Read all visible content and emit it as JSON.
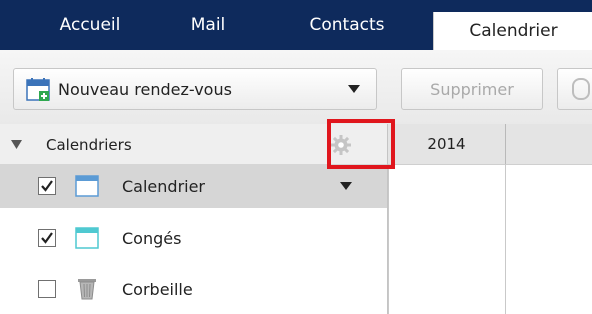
{
  "nav": {
    "tabs": [
      {
        "label": "Accueil"
      },
      {
        "label": "Mail"
      },
      {
        "label": "Contacts"
      },
      {
        "label": "Calendrier",
        "active": true
      }
    ]
  },
  "toolbar": {
    "new_label": "Nouveau rendez-vous",
    "delete_label": "Supprimer"
  },
  "sidebar": {
    "section_title": "Calendriers",
    "items": [
      {
        "label": "Calendrier",
        "checked": true,
        "icon": "calendar-icon"
      },
      {
        "label": "Congés",
        "checked": true,
        "icon": "calendar-icon"
      },
      {
        "label": "Corbeille",
        "checked": false,
        "icon": "trash-icon"
      }
    ]
  },
  "calendar": {
    "year": "2014"
  },
  "colors": {
    "nav_bg": "#0e2a5c",
    "highlight": "#e0161d",
    "calendar_icon": "#5b9bd5",
    "conges_icon": "#4fc9d1"
  }
}
